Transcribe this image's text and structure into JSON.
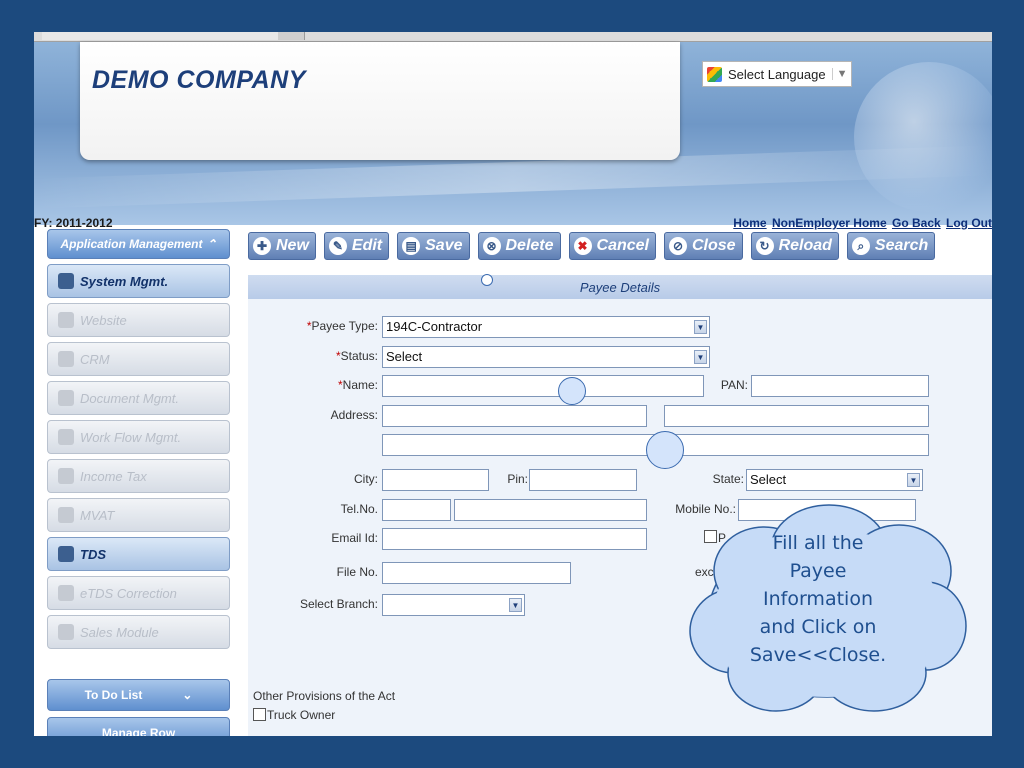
{
  "header": {
    "company": "DEMO COMPANY",
    "language_label": "Select Language",
    "fy": "FY: 2011-2012",
    "links": [
      "Home",
      "NonEmployer Home",
      "Go Back",
      "Log Out"
    ]
  },
  "sidebar": {
    "head": "Application Management",
    "items": [
      {
        "label": "System Mgmt.",
        "active": true
      },
      {
        "label": "Website"
      },
      {
        "label": "CRM"
      },
      {
        "label": "Document Mgmt."
      },
      {
        "label": "Work Flow Mgmt."
      },
      {
        "label": "Income Tax"
      },
      {
        "label": "MVAT"
      },
      {
        "label": "TDS",
        "active": true
      },
      {
        "label": "eTDS Correction"
      },
      {
        "label": "Sales Module"
      }
    ],
    "todo": "To Do List",
    "more": "Manage Row"
  },
  "toolbar": {
    "new": "New",
    "edit": "Edit",
    "save": "Save",
    "delete": "Delete",
    "cancel": "Cancel",
    "close": "Close",
    "reload": "Reload",
    "search": "Search"
  },
  "section": {
    "title": "Payee Details"
  },
  "form": {
    "payee_type_label": "Payee Type:",
    "payee_type_value": "194C-Contractor",
    "status_label": "Status:",
    "status_value": "Select",
    "name_label": "Name:",
    "pan_label": "PAN:",
    "address_label": "Address:",
    "city_label": "City:",
    "pin_label": "Pin:",
    "state_label": "State:",
    "state_value": "Select",
    "tel_label": "Tel.No.",
    "mobile_label": "Mobile No.:",
    "email_label": "Email Id:",
    "file_label": "File No.",
    "branch_label": "Select Branch:",
    "partial_check_label": "P",
    "partial_exc_label": "exc",
    "other_provisions": "Other Provisions of the Act",
    "truck_owner": "Truck Owner"
  },
  "callout": {
    "lines": [
      "Fill all the",
      "Payee",
      "Information",
      "and Click on",
      "Save<<Close."
    ]
  },
  "colors": {
    "page_bg": "#1c4a7e",
    "accent": "#5f8fcf",
    "required": "#c00000"
  }
}
